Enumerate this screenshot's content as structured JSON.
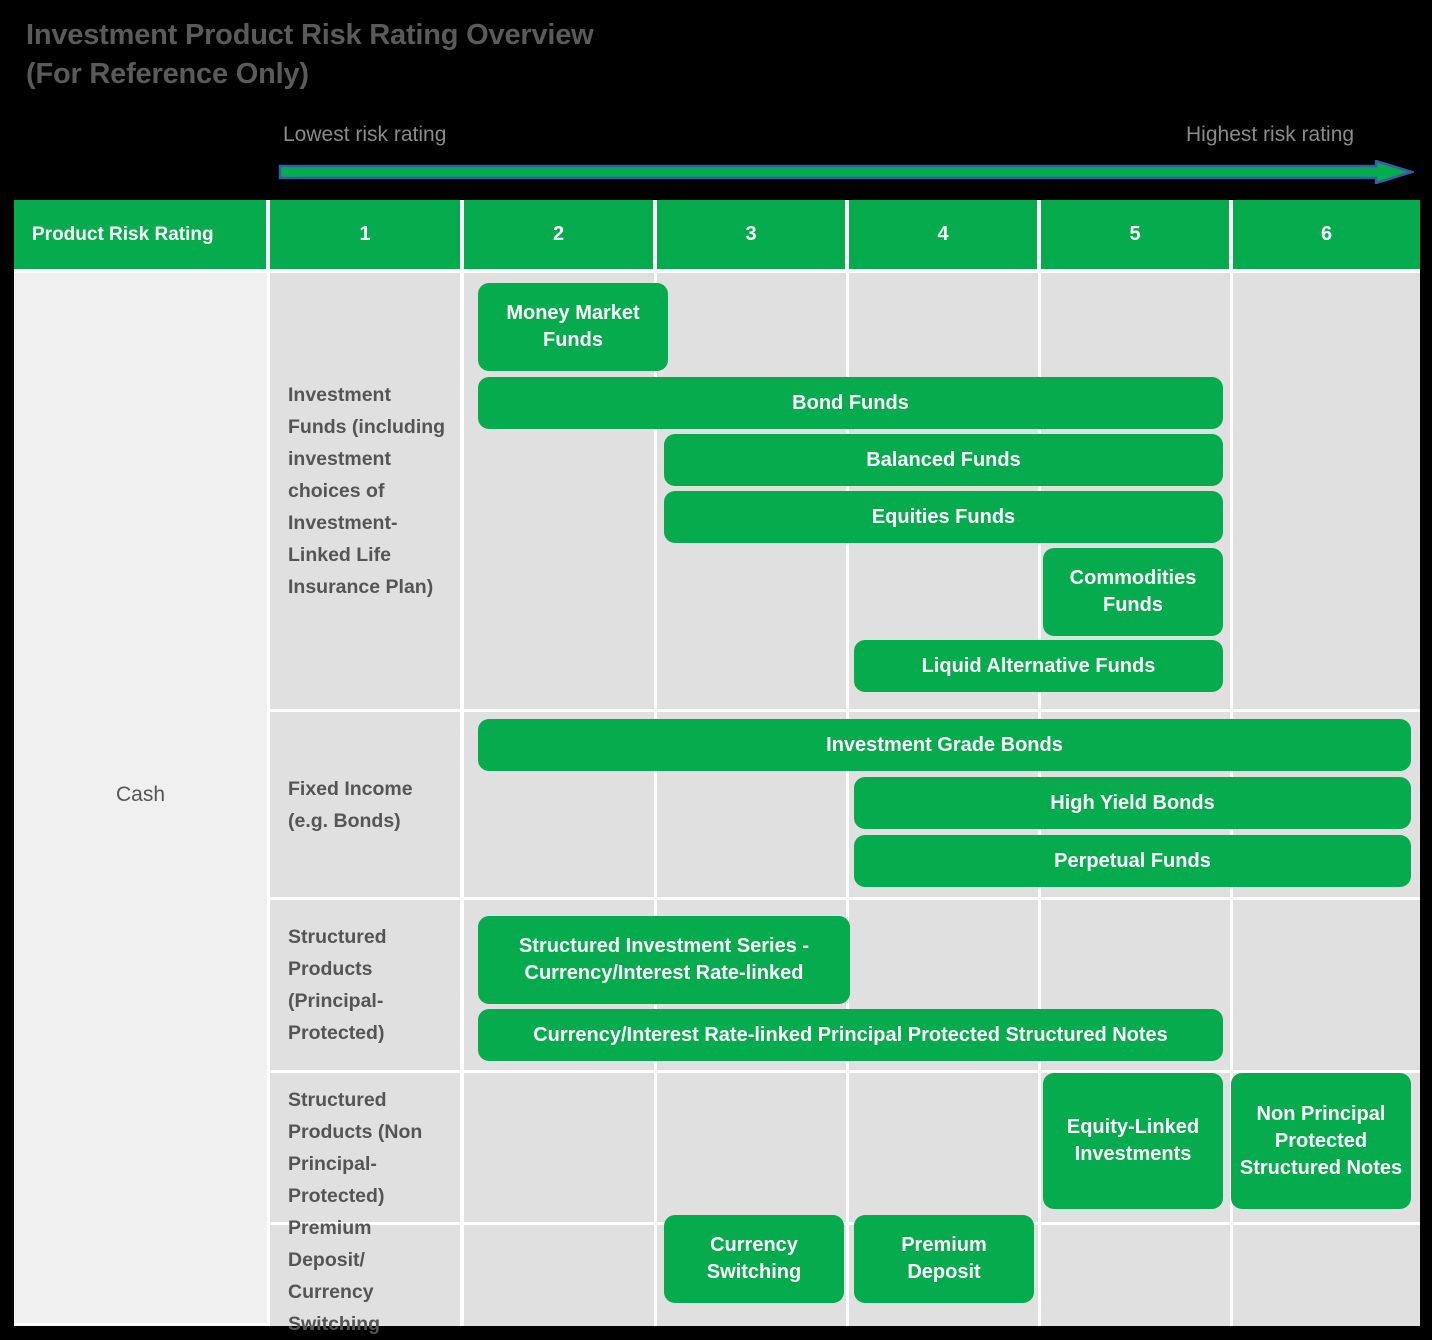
{
  "header": {
    "title": "Investment Product Risk Rating Overview\n(For Reference Only)",
    "scale_left_label": "Lowest risk rating",
    "scale_right_label": "Highest risk rating",
    "arrow_icon": "right-arrow-icon"
  },
  "colors": {
    "brand_green": "#06ab4d",
    "arrow_outline": "#3a59a8",
    "background": "#000000",
    "title_text": "#5a5a5a",
    "cell_grey": "#e0e0e0",
    "cell_grey_light": "#f0f0f0"
  },
  "table": {
    "columns": [
      {
        "label": "Product Risk Rating"
      },
      {
        "label": "1"
      },
      {
        "label": "2"
      },
      {
        "label": "3"
      },
      {
        "label": "4"
      },
      {
        "label": "5"
      },
      {
        "label": "6"
      }
    ],
    "rows": [
      {
        "label": "Investment Funds (including investment choices of Investment-Linked Life Insurance Plan)"
      },
      {
        "label": "Fixed Income (e.g. Bonds)"
      },
      {
        "label": "Structured Products (Principal-Protected)"
      },
      {
        "label": "Structured Products (Non Principal-Protected)"
      },
      {
        "label": "Premium Deposit/ Currency Switching"
      }
    ],
    "cash_label": "Cash"
  },
  "chart_data": {
    "type": "table",
    "title": "Investment Product Risk Rating Overview (For Reference Only)",
    "xlabel": "Product Risk Rating",
    "categories": [
      "1",
      "2",
      "3",
      "4",
      "5",
      "6"
    ],
    "axis_annotations": {
      "low": "Lowest risk rating",
      "high": "Highest risk rating"
    },
    "groups": [
      {
        "name": "Investment Funds (including investment choices of Investment-Linked Life Insurance Plan)",
        "products": [
          {
            "name": "Money Market Funds",
            "rating_from": 2,
            "rating_to": 2
          },
          {
            "name": "Bond Funds",
            "rating_from": 2,
            "rating_to": 5
          },
          {
            "name": "Balanced Funds",
            "rating_from": 3,
            "rating_to": 5
          },
          {
            "name": "Equities Funds",
            "rating_from": 3,
            "rating_to": 5
          },
          {
            "name": "Commodities Funds",
            "rating_from": 5,
            "rating_to": 5
          },
          {
            "name": "Liquid Alternative Funds",
            "rating_from": 4,
            "rating_to": 5
          }
        ]
      },
      {
        "name": "Fixed Income (e.g. Bonds)",
        "products": [
          {
            "name": "Investment Grade Bonds",
            "rating_from": 2,
            "rating_to": 6
          },
          {
            "name": "High Yield Bonds",
            "rating_from": 4,
            "rating_to": 6
          },
          {
            "name": "Perpetual Funds",
            "rating_from": 4,
            "rating_to": 6
          }
        ]
      },
      {
        "name": "Structured Products (Principal-Protected)",
        "products": [
          {
            "name": "Structured Investment Series - Currency/Interest Rate-linked",
            "rating_from": 2,
            "rating_to": 3
          },
          {
            "name": "Currency/Interest Rate-linked Principal Protected Structured Notes",
            "rating_from": 2,
            "rating_to": 5
          }
        ]
      },
      {
        "name": "Structured Products (Non Principal-Protected)",
        "products": [
          {
            "name": "Equity-Linked Investments",
            "rating_from": 5,
            "rating_to": 5
          },
          {
            "name": "Non Principal Protected Structured Notes",
            "rating_from": 6,
            "rating_to": 6
          }
        ]
      },
      {
        "name": "Premium Deposit/ Currency Switching",
        "products": [
          {
            "name": "Currency Switching",
            "rating_from": 3,
            "rating_to": 3
          },
          {
            "name": "Premium Deposit",
            "rating_from": 4,
            "rating_to": 4
          }
        ]
      }
    ],
    "cash": {
      "name": "Cash",
      "rating_from": 1,
      "rating_to": 1
    }
  }
}
